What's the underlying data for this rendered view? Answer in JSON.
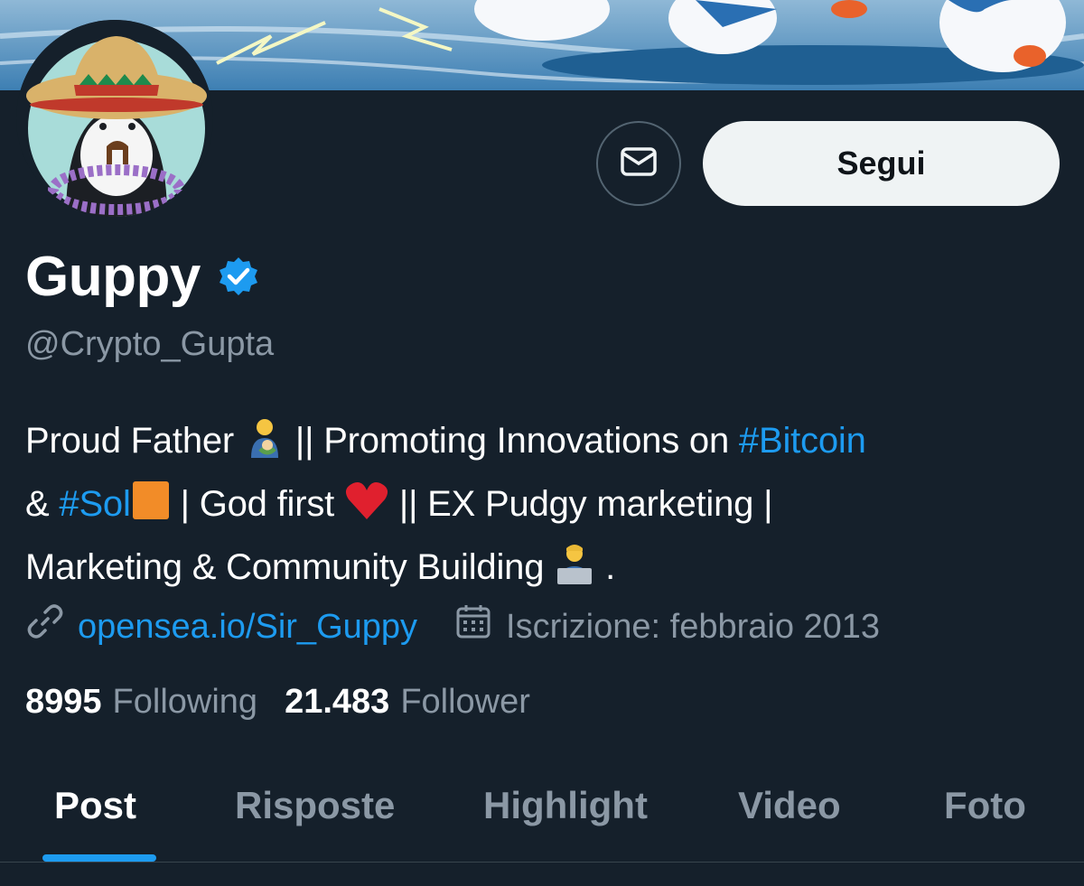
{
  "colors": {
    "background": "#15202b",
    "accent": "#1d9bf0",
    "secondary_text": "#8b98a5",
    "follow_button_bg": "#eff3f4"
  },
  "profile": {
    "name": "Guppy",
    "handle": "@Crypto_Gupta",
    "verified": true,
    "follow_label": "Segui"
  },
  "bio": {
    "line1_a": "Proud Father ",
    "line1_b": " || Promoting Innovations on ",
    "tag_bitcoin": "#Bitcoin",
    "line2_a": "& ",
    "tag_sol": "#Sol",
    "line2_b": " | God first ",
    "line2_c": " || EX Pudgy marketing |",
    "line3_a": "Marketing & Community Building ",
    "line3_b": " ."
  },
  "meta": {
    "link": "opensea.io/Sir_Guppy",
    "joined": "Iscrizione: febbraio 2013"
  },
  "stats": {
    "following_count": "8995",
    "following_label": "Following",
    "followers_count": "21.483",
    "followers_label": "Follower"
  },
  "tabs": [
    {
      "label": "Post",
      "active": true
    },
    {
      "label": "Risposte",
      "active": false
    },
    {
      "label": "Highlight",
      "active": false
    },
    {
      "label": "Video",
      "active": false
    },
    {
      "label": "Foto",
      "active": false
    }
  ]
}
